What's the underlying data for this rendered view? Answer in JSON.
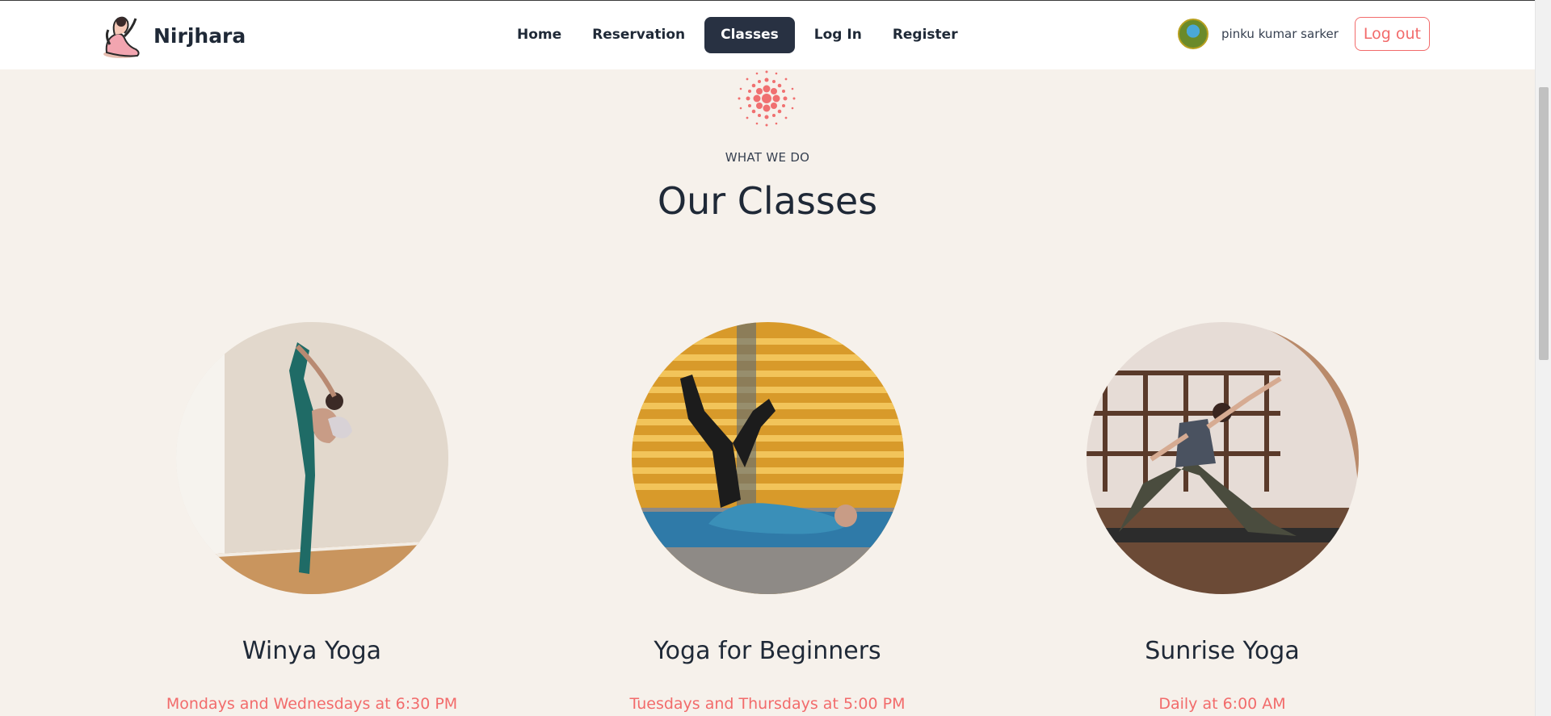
{
  "brand": {
    "name": "Nirjhara",
    "logo_icon": "yoga-pose-logo-icon"
  },
  "nav": {
    "items": [
      {
        "label": "Home",
        "active": false
      },
      {
        "label": "Reservation",
        "active": false
      },
      {
        "label": "Classes",
        "active": true
      },
      {
        "label": "Log In",
        "active": false
      },
      {
        "label": "Register",
        "active": false
      }
    ]
  },
  "user": {
    "name": "pinku kumar sarker",
    "logout_label": "Log out"
  },
  "section": {
    "eyebrow": "WHAT WE DO",
    "title": "Our Classes"
  },
  "classes": [
    {
      "title": "Winya Yoga",
      "schedule": "Mondays and Wednesdays at 6:30 PM"
    },
    {
      "title": "Yoga for Beginners",
      "schedule": "Tuesdays and Thursdays at 5:00 PM"
    },
    {
      "title": "Sunrise Yoga",
      "schedule": "Daily at 6:00 AM"
    }
  ],
  "colors": {
    "accent": "#f26b6b",
    "nav_active_bg": "#283142",
    "page_bg": "#f6f1eb",
    "text": "#1f2937"
  }
}
